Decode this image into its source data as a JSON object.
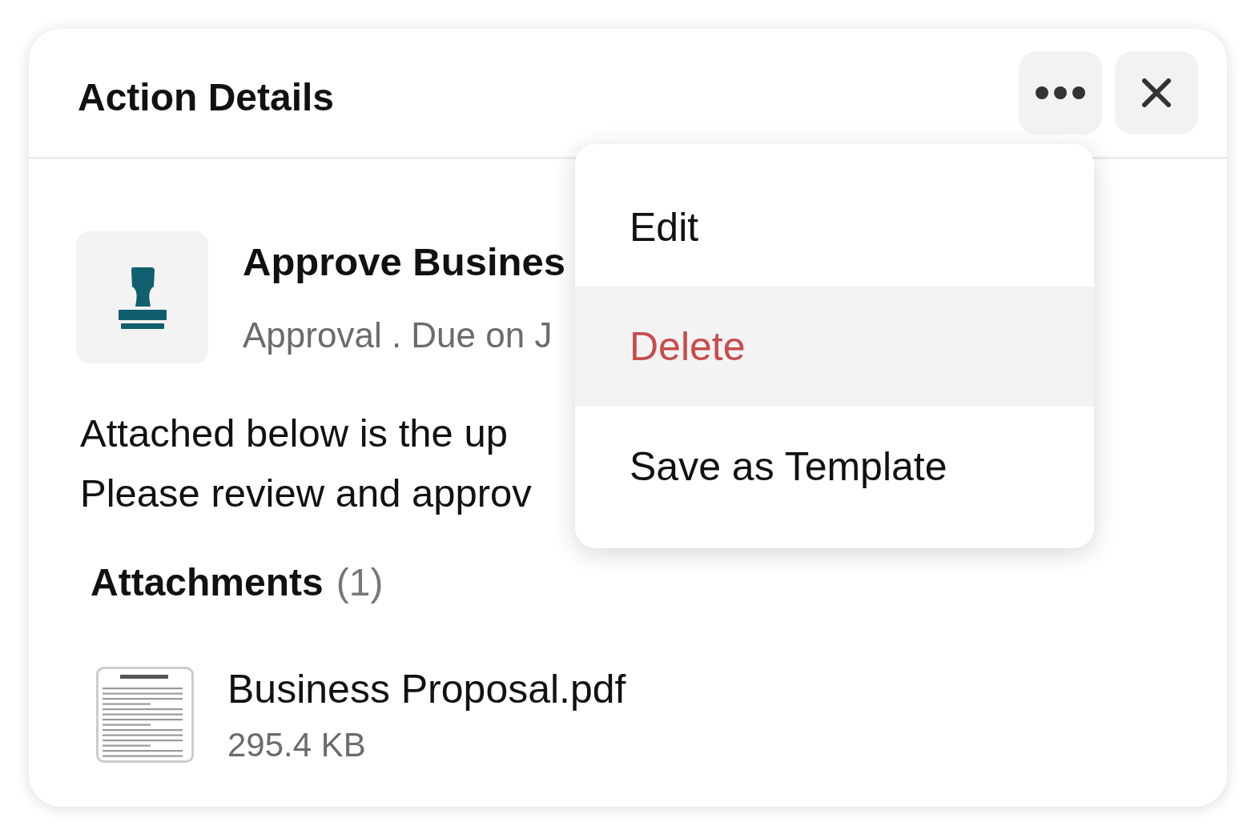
{
  "panel": {
    "title": "Action Details"
  },
  "action": {
    "title": "Approve Busines",
    "subtitle": "Approval . Due on J"
  },
  "description": [
    "Attached below is the up",
    "Please review and approv"
  ],
  "attachments": {
    "heading": "Attachments",
    "count": "(1)",
    "files": [
      {
        "name": "Business Proposal.pdf",
        "size": "295.4 KB"
      }
    ]
  },
  "menu": [
    {
      "label": "Edit",
      "kind": "normal",
      "selected": false
    },
    {
      "label": "Delete",
      "kind": "destructive",
      "selected": true
    },
    {
      "label": "Save as Template",
      "kind": "normal",
      "selected": false
    }
  ]
}
